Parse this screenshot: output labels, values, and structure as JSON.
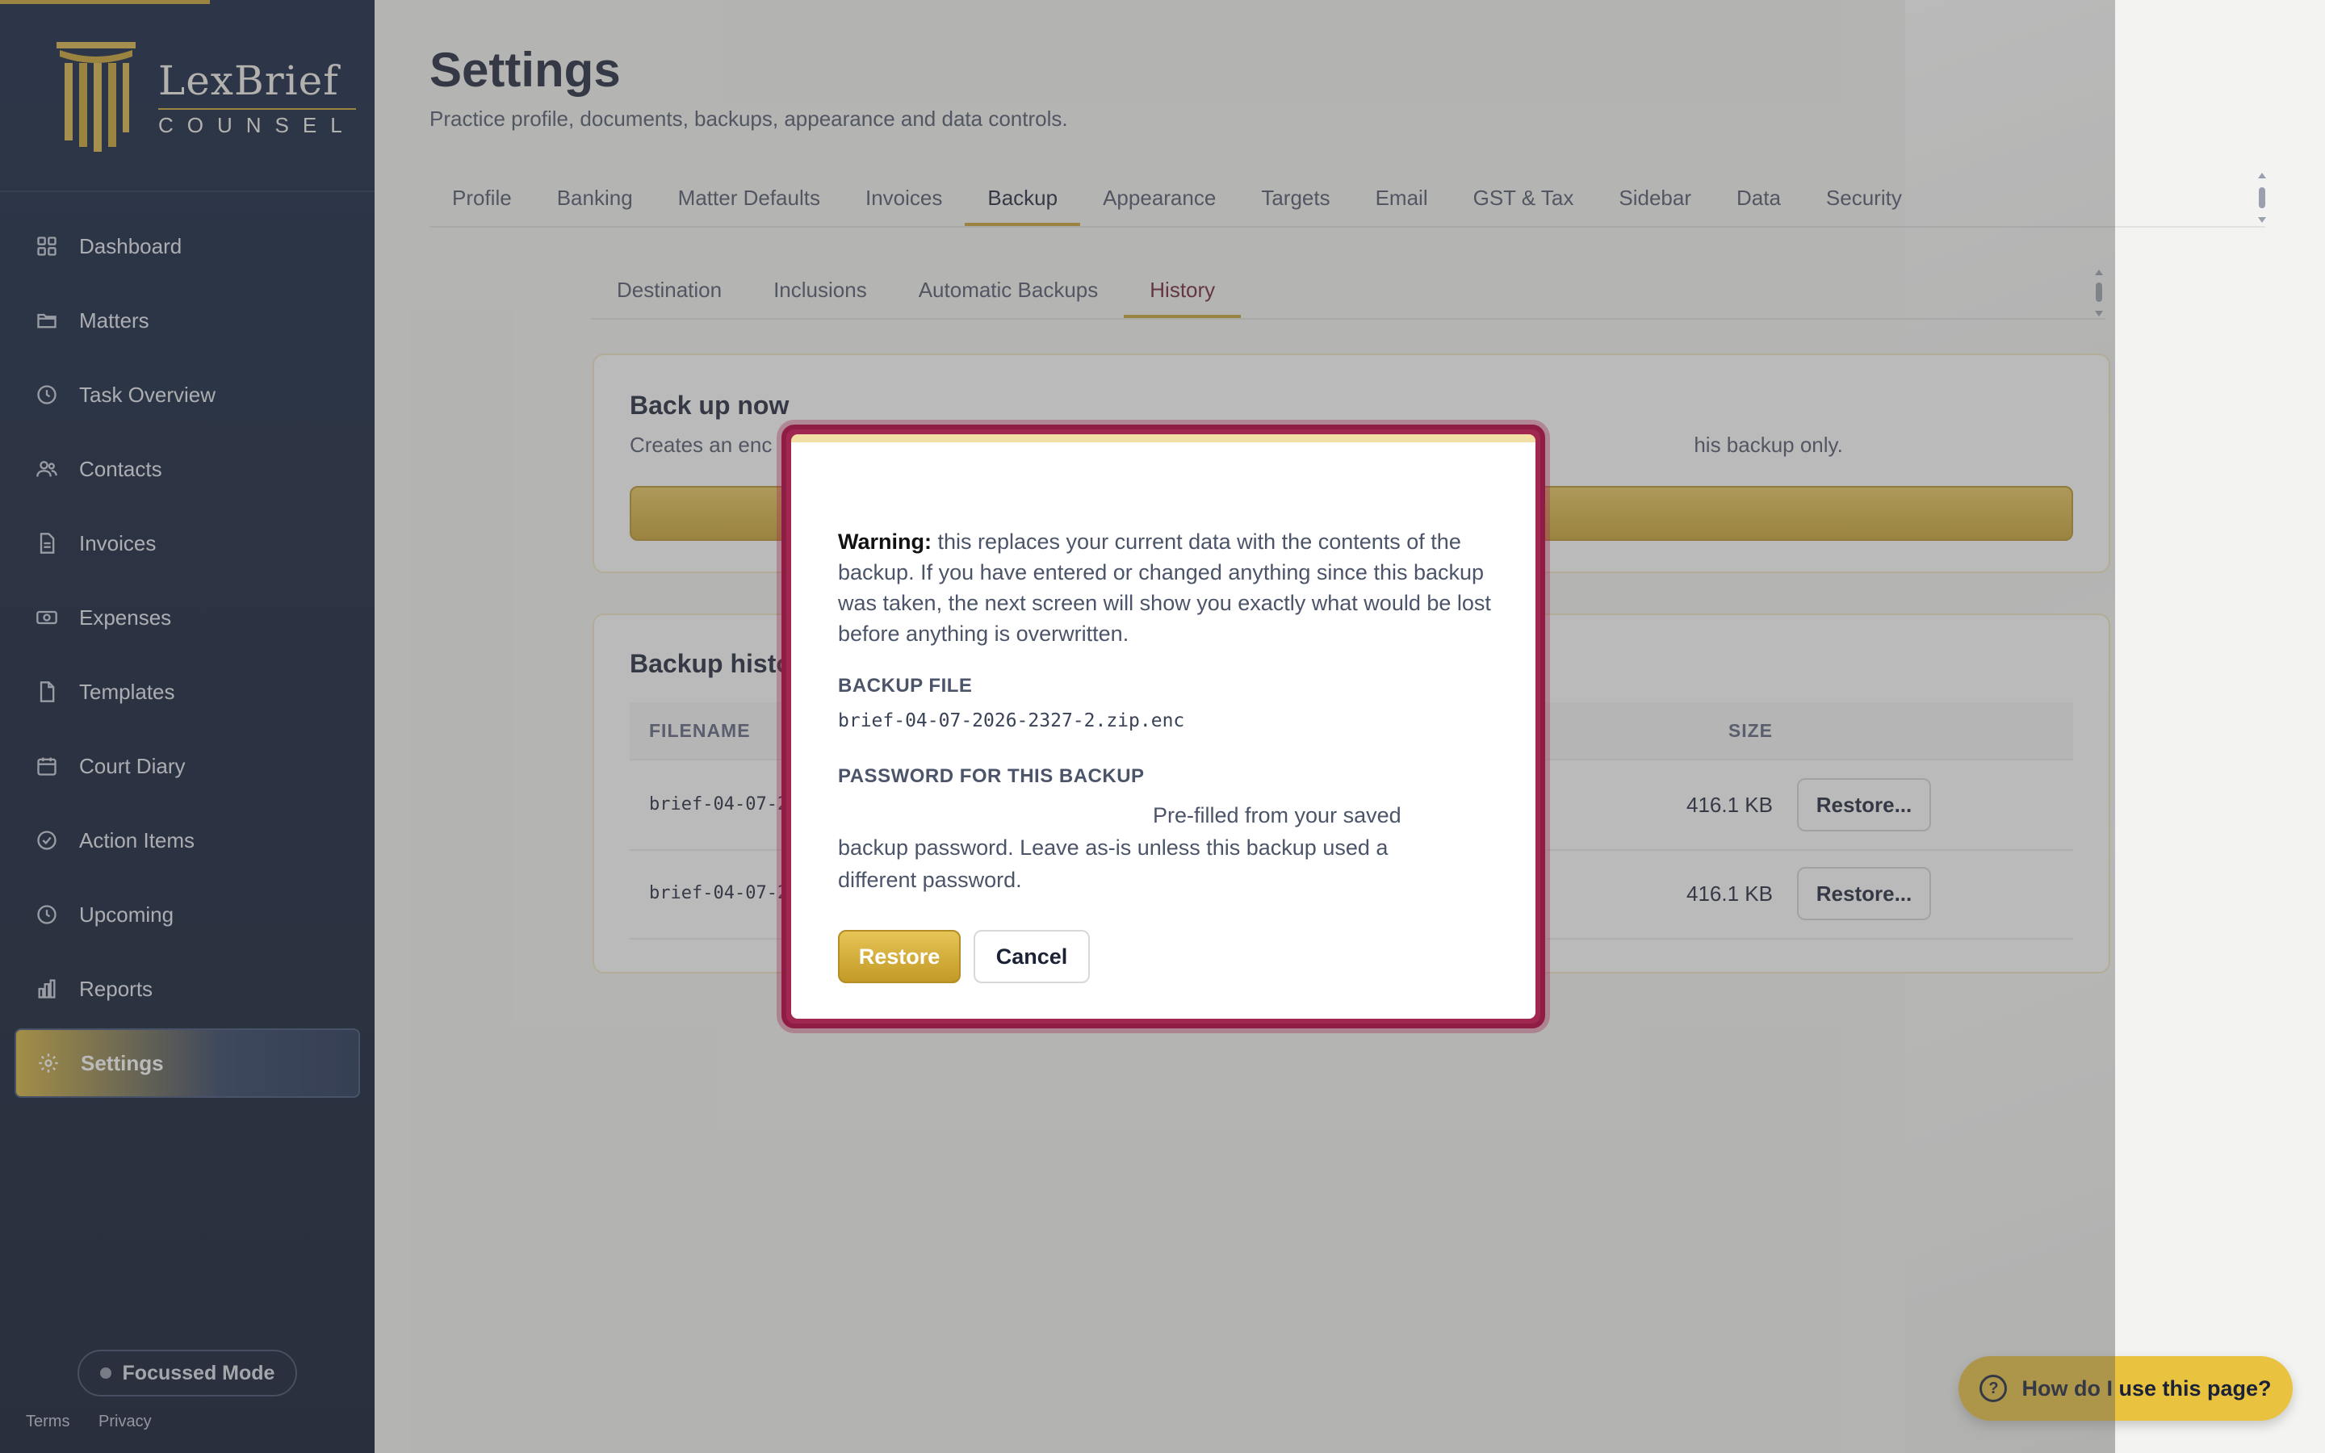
{
  "brand": {
    "name_line1": "LexBrief",
    "name_line2": "COUNSEL"
  },
  "sidebar": {
    "items": [
      {
        "label": "Dashboard",
        "icon": "grid-icon"
      },
      {
        "label": "Matters",
        "icon": "folder-icon"
      },
      {
        "label": "Task Overview",
        "icon": "clock-icon"
      },
      {
        "label": "Contacts",
        "icon": "users-icon"
      },
      {
        "label": "Invoices",
        "icon": "file-text-icon"
      },
      {
        "label": "Expenses",
        "icon": "banknote-icon"
      },
      {
        "label": "Templates",
        "icon": "file-icon"
      },
      {
        "label": "Court Diary",
        "icon": "calendar-icon"
      },
      {
        "label": "Action Items",
        "icon": "check-circle-icon"
      },
      {
        "label": "Upcoming",
        "icon": "clock-icon"
      },
      {
        "label": "Reports",
        "icon": "bar-chart-icon"
      },
      {
        "label": "Settings",
        "icon": "gear-icon",
        "active": true
      }
    ],
    "focus_mode": "Focussed Mode",
    "terms": "Terms",
    "privacy": "Privacy"
  },
  "page": {
    "title": "Settings",
    "subtitle": "Practice profile, documents, backups, appearance and data controls."
  },
  "tabs": [
    "Profile",
    "Banking",
    "Matter Defaults",
    "Invoices",
    "Backup",
    "Appearance",
    "Targets",
    "Email",
    "GST & Tax",
    "Sidebar",
    "Data",
    "Security"
  ],
  "active_tab": "Backup",
  "subtabs": [
    "Destination",
    "Inclusions",
    "Automatic Backups",
    "History"
  ],
  "active_subtab": "History",
  "backup_now": {
    "title": "Back up now",
    "description_start": "Creates an enc",
    "description_end": "his backup only."
  },
  "history": {
    "title": "Backup histo",
    "columns": {
      "filename": "FILENAME",
      "size": "SIZE"
    },
    "rows": [
      {
        "filename": "brief-04-07-20",
        "size": "416.1 KB",
        "action": "Restore..."
      },
      {
        "filename": "brief-04-07-20",
        "size": "416.1 KB",
        "action": "Restore..."
      }
    ]
  },
  "modal": {
    "warning_label": "Warning:",
    "warning_text": " this replaces your current data with the contents of the backup. If you have entered or changed anything since this backup was taken, the next screen will show you exactly what would be lost before anything is overwritten.",
    "file_label": "BACKUP FILE",
    "file_name": "brief-04-07-2026-2327-2.zip.enc",
    "password_label": "PASSWORD FOR THIS BACKUP",
    "password_hint": "Pre-filled from your saved backup password. Leave as-is unless this backup used a different password.",
    "restore_label": "Restore",
    "cancel_label": "Cancel"
  },
  "help_button": "How do I use this page?",
  "colors": {
    "accent_gold": "#c9a22d",
    "sidebar_navy": "#0d1d3c",
    "modal_border": "#a02750"
  }
}
